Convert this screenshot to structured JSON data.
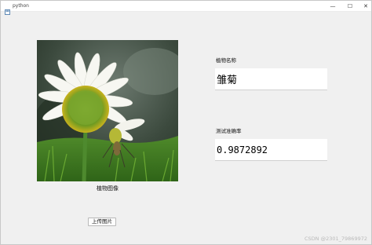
{
  "window": {
    "title": "python",
    "controls": {
      "minimize": "—",
      "maximize": "☐",
      "close": "✕"
    }
  },
  "image_panel": {
    "caption": "植物图像",
    "icon": "daisy-photo"
  },
  "upload": {
    "label": "上传图片"
  },
  "result": {
    "name_label": "植物名称",
    "name_value": "雏菊",
    "accuracy_label": "测试准确率",
    "accuracy_value": "0.9872892"
  },
  "watermark": "CSDN @2301_79869972",
  "colors": {
    "window_bg": "#f0f0f0",
    "field_bg": "#ffffff"
  }
}
